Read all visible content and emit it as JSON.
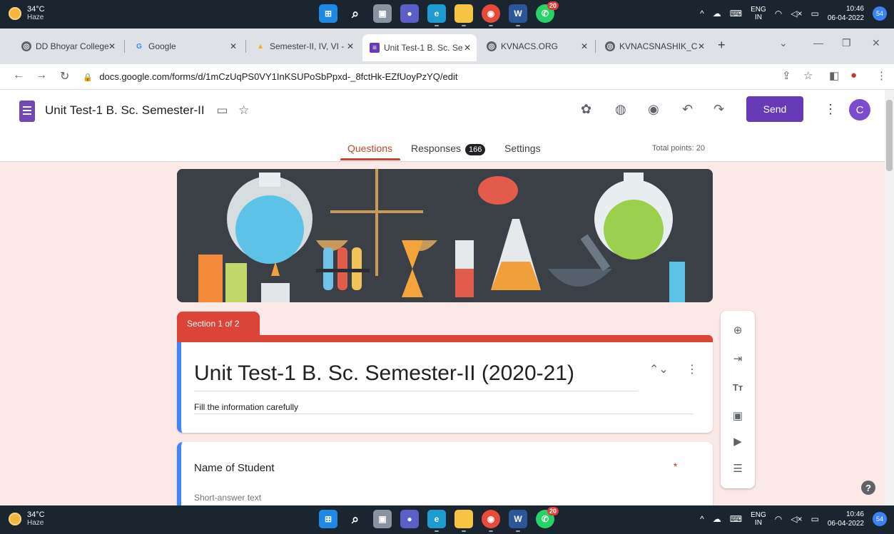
{
  "taskbar": {
    "temperature": "34°C",
    "condition": "Haze",
    "whatsapp_badge": "20",
    "lang_line1": "ENG",
    "lang_line2": "IN",
    "time": "10:46",
    "date": "06-04-2022",
    "notifications": "54",
    "apps": [
      "windows-start",
      "search",
      "task-view",
      "teams-chat",
      "edge",
      "file-explorer",
      "chrome",
      "word",
      "whatsapp"
    ]
  },
  "browser": {
    "tabs": [
      {
        "title": "DD Bhoyar College",
        "icon": "chrome-icon",
        "color": "#5f6368"
      },
      {
        "title": "Google",
        "icon": "google-icon",
        "color": "#4285f4"
      },
      {
        "title": "Semester-II, IV, VI -",
        "icon": "drive-icon",
        "color": "#f4b400"
      },
      {
        "title": "Unit Test-1 B. Sc. Se",
        "icon": "forms-icon",
        "color": "#673ab7"
      },
      {
        "title": "KVNACS.ORG",
        "icon": "chrome-icon",
        "color": "#5f6368"
      },
      {
        "title": "KVNACSNASHIK_C",
        "icon": "chrome-icon",
        "color": "#5f6368"
      }
    ],
    "url": "docs.google.com/forms/d/1mCzUqPS0VY1InKSUPoSbPpxd-_8fctHk-EZfUoyPzYQ/edit"
  },
  "forms": {
    "doc_title": "Unit Test-1 B. Sc. Semester-II",
    "send_label": "Send",
    "avatar_letter": "C",
    "tabs": {
      "questions": "Questions",
      "responses": "Responses",
      "responses_count": "166",
      "settings": "Settings"
    },
    "total_points": "Total points: 20",
    "section_label": "Section 1 of 2",
    "form_title": "Unit Test-1 B. Sc. Semester-II (2020-21)",
    "form_description": "Fill the information carefully",
    "question": {
      "label": "Name of Student",
      "required_mark": "*",
      "placeholder": "Short-answer text"
    },
    "help": "?"
  },
  "colors": {
    "accent_purple": "#673ab7",
    "theme_red": "#db4437",
    "background_pink": "#fbe9e7",
    "banner_dark": "#3b3f46"
  }
}
